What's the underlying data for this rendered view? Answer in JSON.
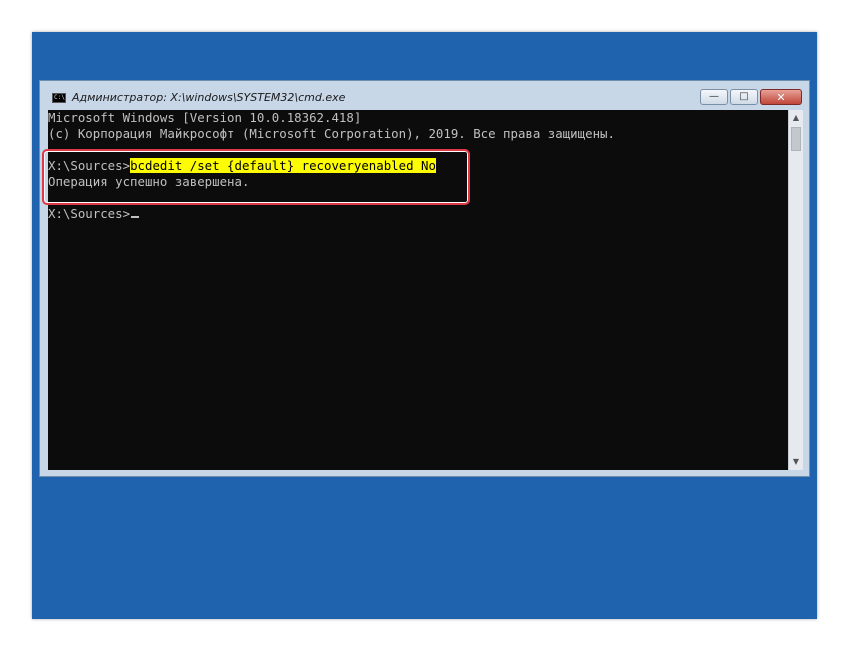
{
  "window": {
    "title": "Администратор: X:\\windows\\SYSTEM32\\cmd.exe",
    "icon": "cmd-icon",
    "icon_text": "C:\\",
    "minimize_label": "—",
    "maximize_label": "□",
    "close_label": "✕"
  },
  "console": {
    "lines": [
      "Microsoft Windows [Version 10.0.18362.418]",
      "(c) Корпорация Майкрософт (Microsoft Corporation), 2019. Все права защищены.",
      "",
      "",
      "Операция успешно завершена.",
      ""
    ],
    "prompt1": "X:\\Sources>",
    "command": "bcdedit /set {default} recoveryenabled No",
    "prompt2": "X:\\Sources>"
  },
  "colors": {
    "desktop": "#1f62ad",
    "console_bg": "#0c0c0c",
    "console_text": "#c0c0c0",
    "highlight": "#fdfd00",
    "annotation_box": "#e03946"
  },
  "scrollbar": {
    "up_arrow": "▲",
    "down_arrow": "▼"
  }
}
